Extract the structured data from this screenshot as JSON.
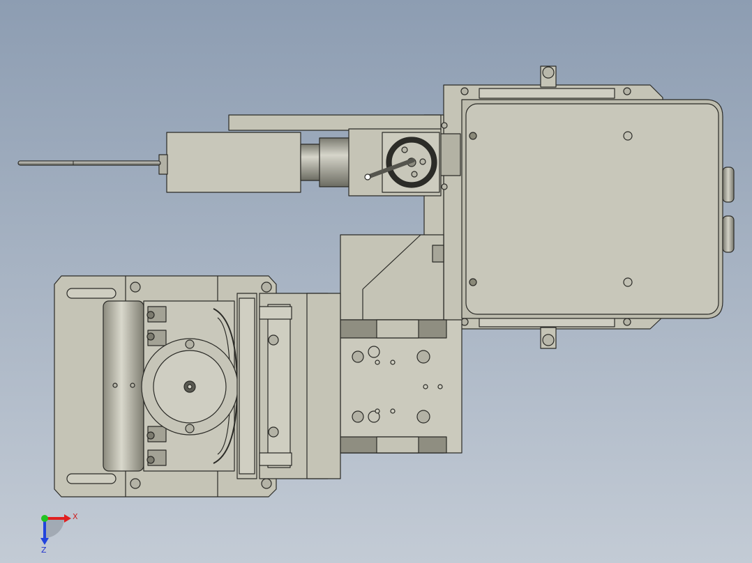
{
  "viewport": {
    "background_top": "#8d9db2",
    "background_bottom": "#c3cbd5"
  },
  "model": {
    "part_color": "#c5c4b6",
    "part_dark": "#8a8979",
    "edge_color": "#2a2a26",
    "metal_color": "#a9a9a3"
  },
  "triad": {
    "x_label": "X",
    "z_label": "Z",
    "x_color": "#e02020",
    "y_color": "#22c422",
    "z_color": "#2244dd"
  }
}
